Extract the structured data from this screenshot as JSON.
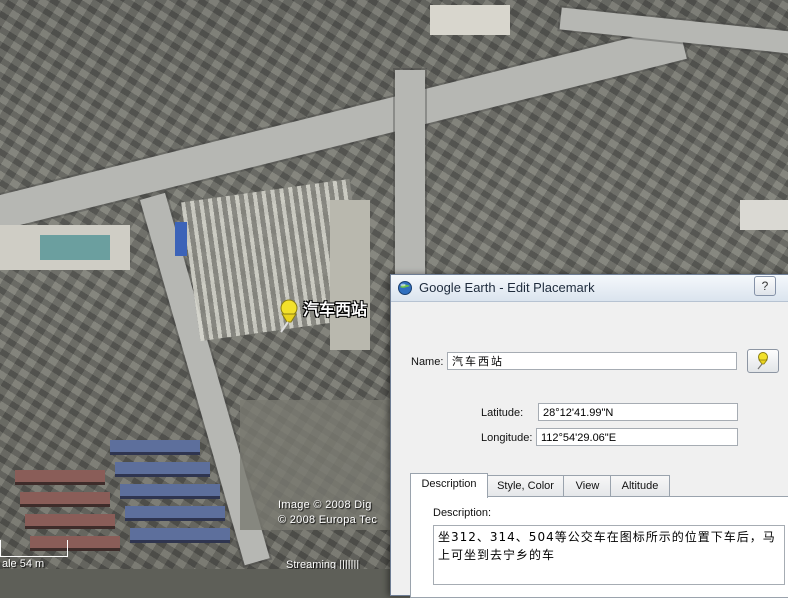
{
  "map": {
    "placemark_label": "汽车西站",
    "copyright_1": "Image © 2008 Dig",
    "copyright_2": "© 2008 Europa Tec",
    "scale_text": "ale    54 m",
    "streaming": "Streaming |||||||"
  },
  "dialog": {
    "title": "Google Earth - Edit Placemark",
    "help_label": "?",
    "name_label": "Name:",
    "name_value": "汽车西站",
    "latitude_label": "Latitude:",
    "latitude_value": "28°12'41.99\"N",
    "longitude_label": "Longitude:",
    "longitude_value": "112°54'29.06\"E",
    "tabs": [
      {
        "label": "Description",
        "active": true
      },
      {
        "label": "Style, Color",
        "active": false
      },
      {
        "label": "View",
        "active": false
      },
      {
        "label": "Altitude",
        "active": false
      }
    ],
    "description_label": "Description:",
    "description_text": "坐312、314、504等公交车在图标所示的位置下车后，马上可坐到去宁乡的车"
  },
  "icons": {
    "title_icon": "google-earth-globe-icon",
    "pin": "yellow-pushpin-icon"
  },
  "colors": {
    "pin_yellow": "#f2e12b",
    "titlebar": "#dbe4ee",
    "dialog_bg": "#f0f0f0"
  }
}
